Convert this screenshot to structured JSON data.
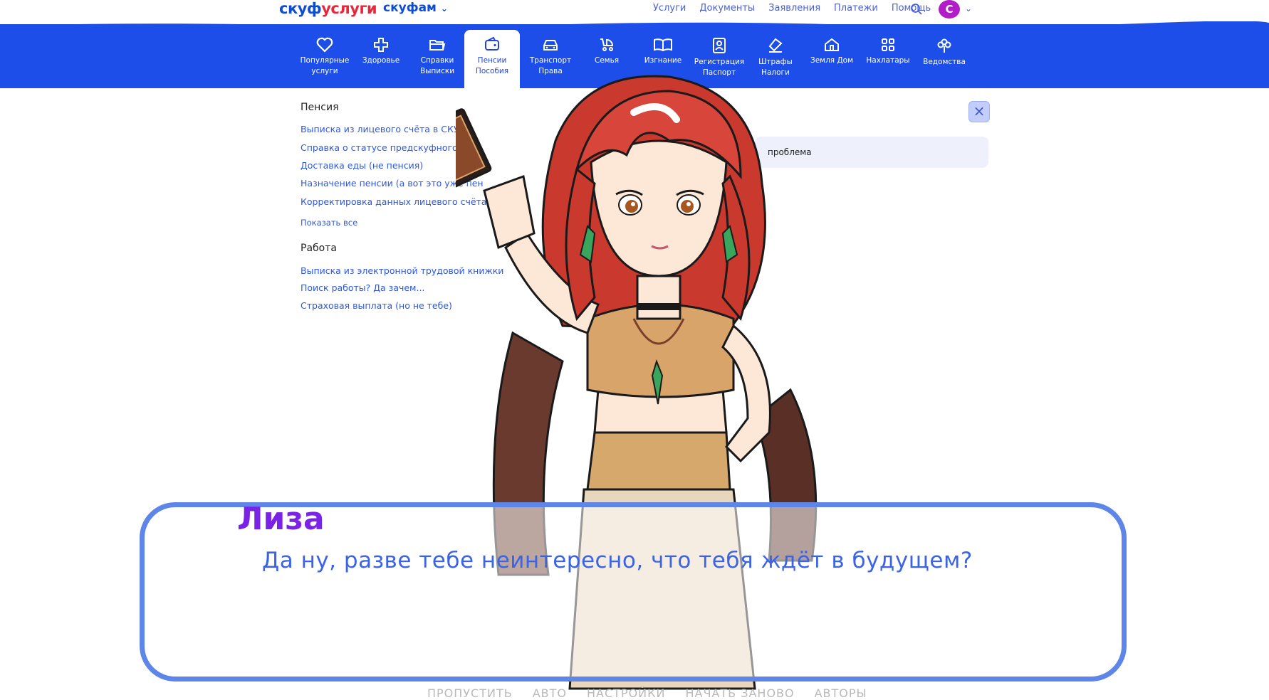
{
  "header": {
    "brand_part1": "скуф",
    "brand_part2": "услуги",
    "brand_secondary": "скуфам",
    "nav": [
      "Услуги",
      "Документы",
      "Заявления",
      "Платежи",
      "Помощь"
    ],
    "avatar_letter": "С"
  },
  "categories": [
    {
      "label": "Популярные\nуслуги",
      "icon": "heart-icon"
    },
    {
      "label": "Здоровье",
      "icon": "health-cross-icon"
    },
    {
      "label": "Справки\nВыписки",
      "icon": "folder-icon"
    },
    {
      "label": "Пенсии\nПособия",
      "icon": "wallet-icon"
    },
    {
      "label": "Транспорт\nПрава",
      "icon": "car-icon"
    },
    {
      "label": "Семья",
      "icon": "stroller-icon"
    },
    {
      "label": "Изгнание",
      "icon": "book-icon"
    },
    {
      "label": "Регистрация\nПаспорт",
      "icon": "id-card-icon"
    },
    {
      "label": "Штрафы\nНалоги",
      "icon": "fines-icon"
    },
    {
      "label": "Земля Дом",
      "icon": "house-icon"
    },
    {
      "label": "Нахлатары",
      "icon": "grid-icon"
    },
    {
      "label": "Ведомства",
      "icon": "flower-icon"
    }
  ],
  "active_category": "Пенсии\nПособия",
  "panel": {
    "pension_title": "Пенсия",
    "pension_links": [
      "Выписка из лицевого счёта в СКУФР",
      "Справка о статусе   предскуфного",
      "Доставка еды (не пенсия)",
      "Назначение пенсии  (а вот это уже пен",
      "Корректировка данных лицевого счёта  СК"
    ],
    "show_all": "Показать все",
    "work_title": "Работа",
    "work_links": [
      "Выписка из электронной трудовой книжки",
      "Поиск работы?  Да зачем...",
      "Страховая выплата  (но не тебе)"
    ],
    "problem_text": "проблема"
  },
  "dialog": {
    "speaker": "Лиза",
    "text": "Да ну, разве тебе неинтересно, что тебя ждёт в будущем?"
  },
  "game_menu": [
    "ПРОПУСТИТЬ",
    "АВТО",
    "НАСТРОЙКИ",
    "НАЧАТЬ ЗАНОВО",
    "АВТОРЫ"
  ],
  "colors": {
    "band": "#1d4ee9",
    "link": "#2c57e0",
    "speaker": "#7a22e6",
    "dialog_border": "#5d86e8",
    "dialog_text": "#3b63e6"
  }
}
